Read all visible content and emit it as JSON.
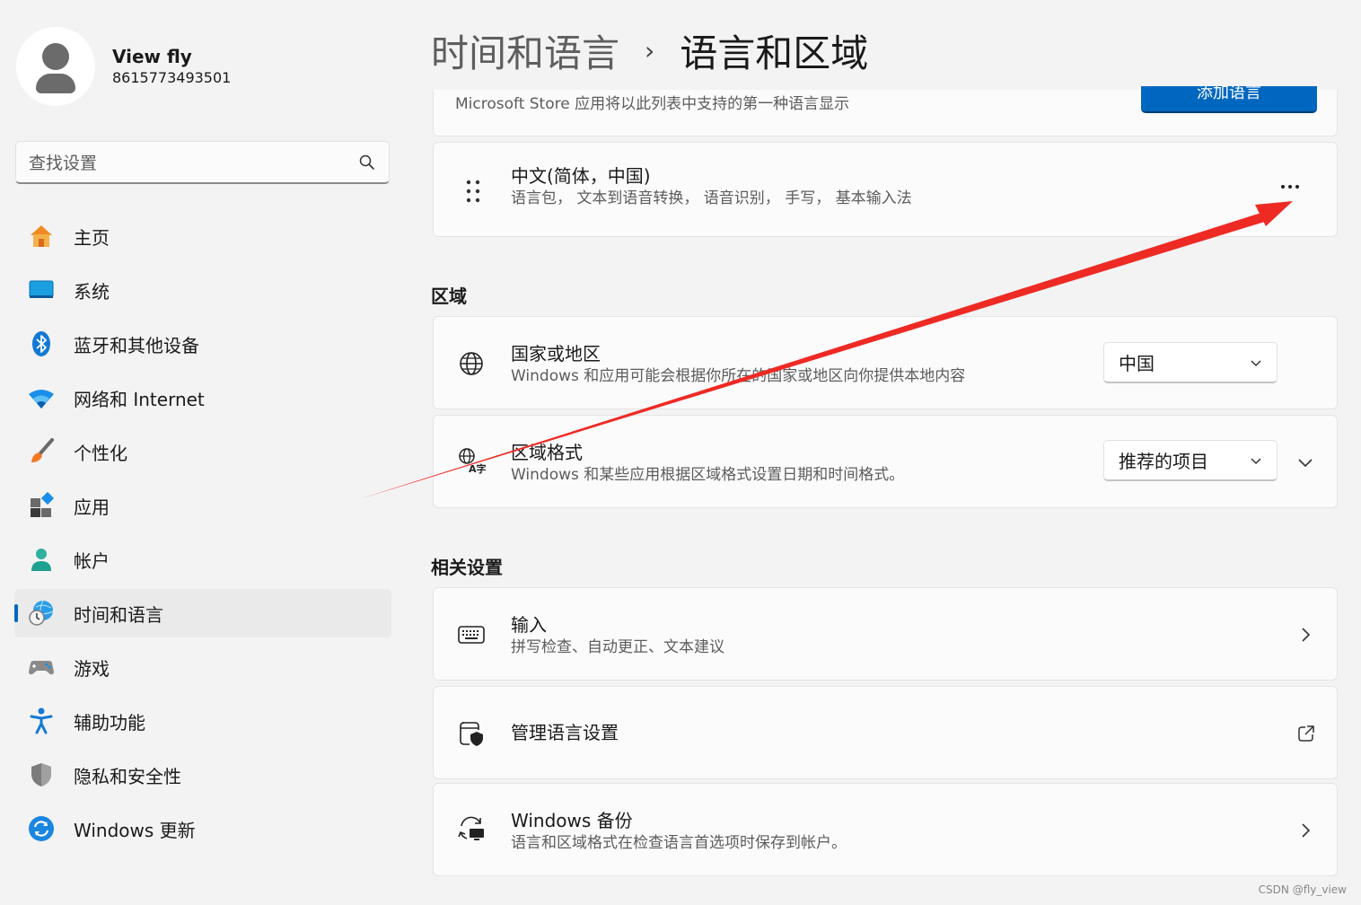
{
  "user": {
    "name": "View fly",
    "id": "8615773493501"
  },
  "search": {
    "placeholder": "查找设置"
  },
  "nav": [
    {
      "label": "主页",
      "icon": "home-icon",
      "active": false
    },
    {
      "label": "系统",
      "icon": "system-icon",
      "active": false
    },
    {
      "label": "蓝牙和其他设备",
      "icon": "bluetooth-icon",
      "active": false
    },
    {
      "label": "网络和 Internet",
      "icon": "wifi-icon",
      "active": false
    },
    {
      "label": "个性化",
      "icon": "brush-icon",
      "active": false
    },
    {
      "label": "应用",
      "icon": "apps-icon",
      "active": false
    },
    {
      "label": "帐户",
      "icon": "account-icon",
      "active": false
    },
    {
      "label": "时间和语言",
      "icon": "time-language-icon",
      "active": true
    },
    {
      "label": "游戏",
      "icon": "gamepad-icon",
      "active": false
    },
    {
      "label": "辅助功能",
      "icon": "accessibility-icon",
      "active": false
    },
    {
      "label": "隐私和安全性",
      "icon": "shield-icon",
      "active": false
    },
    {
      "label": "Windows 更新",
      "icon": "update-icon",
      "active": false
    }
  ],
  "breadcrumb": {
    "parent": "时间和语言",
    "separator": "›",
    "current": "语言和区域"
  },
  "preferred_languages": {
    "store_note": "Microsoft Store 应用将以此列表中支持的第一种语言显示",
    "add_button": "添加语言",
    "language": {
      "name": "中文(简体，中国)",
      "features": "语言包， 文本到语音转换， 语音识别， 手写， 基本输入法"
    }
  },
  "region": {
    "heading": "区域",
    "country": {
      "title": "国家或地区",
      "desc": "Windows 和应用可能会根据你所在的国家或地区向你提供本地内容",
      "value": "中国"
    },
    "format": {
      "title": "区域格式",
      "desc": "Windows 和某些应用根据区域格式设置日期和时间格式。",
      "value": "推荐的项目"
    }
  },
  "related": {
    "heading": "相关设置",
    "input": {
      "title": "输入",
      "desc": "拼写检查、自动更正、文本建议"
    },
    "manage": {
      "title": "管理语言设置"
    },
    "backup": {
      "title": "Windows 备份",
      "desc": "语言和区域格式在检查语言首选项时保存到帐户。"
    }
  },
  "watermark": "CSDN @fly_view",
  "colors": {
    "accent": "#0067c0",
    "annotation_arrow": "#ee2a24",
    "background": "#f3f3f3",
    "card": "#fbfbfb"
  }
}
